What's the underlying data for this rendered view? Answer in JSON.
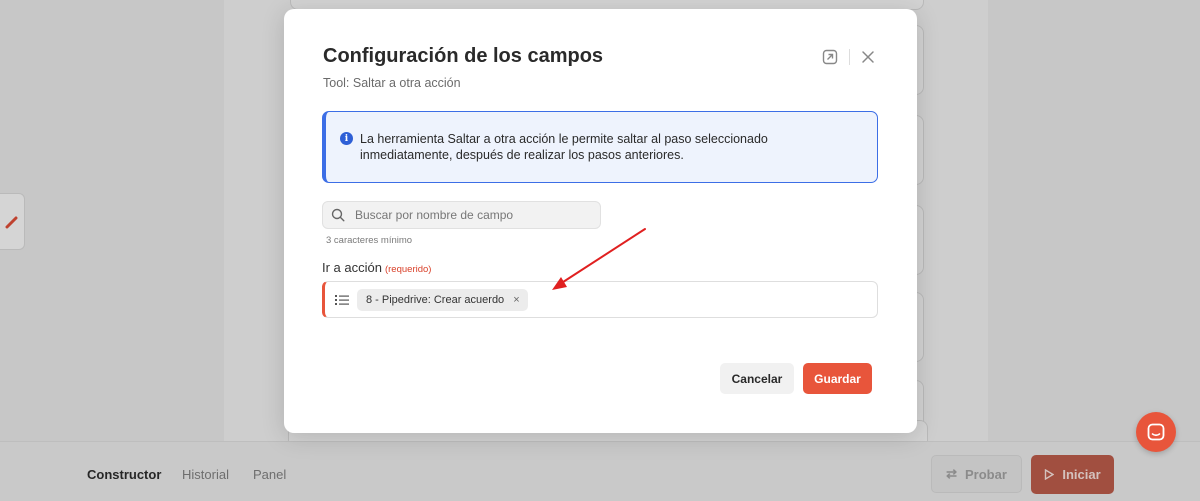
{
  "background": {
    "tabs": [
      {
        "label": "Constructor",
        "active": true
      },
      {
        "label": "Historial",
        "active": false
      },
      {
        "label": "Panel",
        "active": false
      }
    ],
    "probar_label": "Probar",
    "iniciar_label": "Iniciar"
  },
  "modal": {
    "title": "Configuración de los campos",
    "subtitle": "Tool: Saltar a otra acción",
    "info_text": "La herramienta Saltar a otra acción le permite saltar al paso seleccionado inmediatamente, después de realizar los pasos anteriores.",
    "search": {
      "placeholder": "Buscar por nombre de campo",
      "value": "",
      "hint": "3 caracteres mínimo"
    },
    "field": {
      "label": "Ir a acción",
      "required_text": "(requerido)",
      "chip_label": "8 - Pipedrive: Crear acuerdo",
      "chip_remove": "×"
    },
    "cancel_label": "Cancelar",
    "save_label": "Guardar"
  },
  "colors": {
    "accent": "#e8553b",
    "info_border": "#3c6ee6",
    "info_bg": "#eef3fd",
    "annotation_arrow": "#e02020"
  },
  "icons": [
    "search-icon",
    "info-icon",
    "list-icon",
    "close-icon",
    "expand-icon",
    "swap-icon",
    "play-icon",
    "chat-icon"
  ]
}
